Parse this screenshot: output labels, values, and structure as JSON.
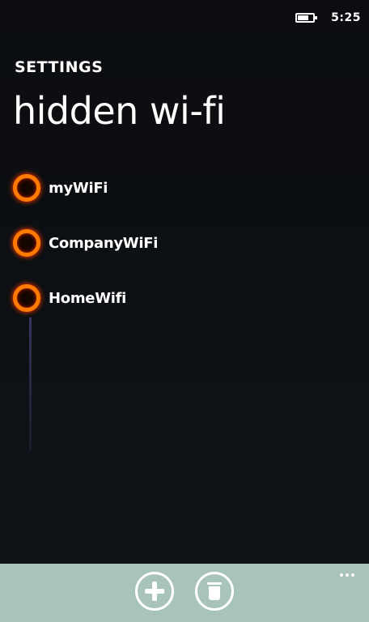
{
  "status_bar": {
    "battery_icon": "battery-icon",
    "battery_level": 0.7,
    "time": "5:25"
  },
  "header": {
    "app_title": "SETTINGS",
    "page_title": "hidden wi-fi"
  },
  "networks": [
    {
      "name": "myWiFi",
      "icon": "radio-icon"
    },
    {
      "name": "CompanyWiFi",
      "icon": "radio-icon"
    },
    {
      "name": "HomeWifi",
      "icon": "radio-icon"
    }
  ],
  "app_bar": {
    "buttons": [
      {
        "icon": "add-icon"
      },
      {
        "icon": "delete-icon"
      }
    ],
    "more_icon": "more-icon",
    "background": "#a8c3bc"
  },
  "colors": {
    "accent": "#ff7a00",
    "background": "#0c0e12",
    "foreground": "#ffffff"
  }
}
